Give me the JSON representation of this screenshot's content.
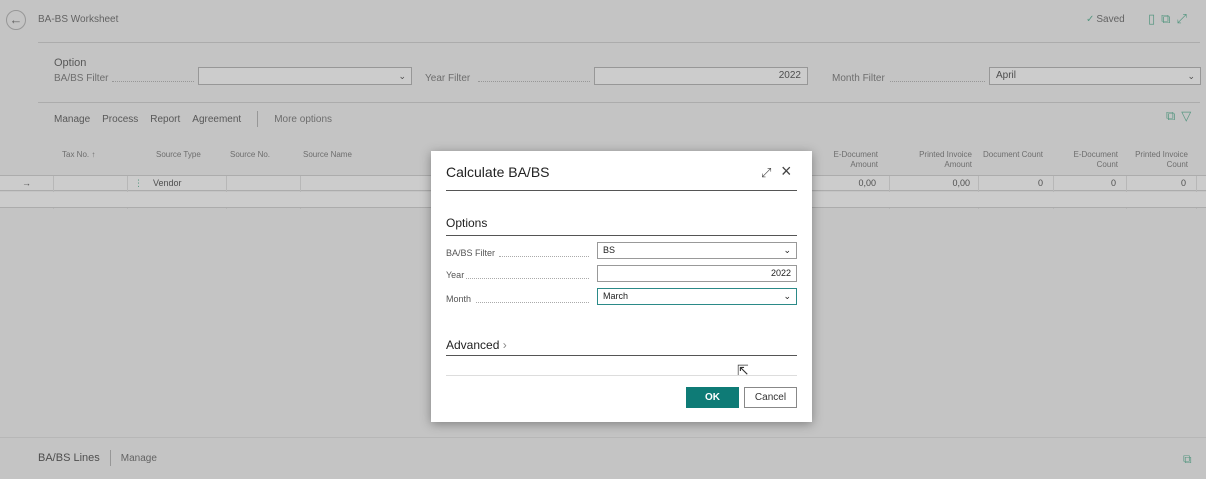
{
  "header": {
    "title": "BA-BS Worksheet",
    "saved_label": "Saved"
  },
  "options": {
    "title": "Option",
    "babs_filter_label": "BA/BS Filter",
    "babs_filter_value": "",
    "year_filter_label": "Year Filter",
    "year_filter_value": "2022",
    "month_filter_label": "Month Filter",
    "month_filter_value": "April"
  },
  "actions": [
    "Manage",
    "Process",
    "Report",
    "Agreement"
  ],
  "more_options": "More options",
  "grid": {
    "columns": [
      "Tax No. ↑",
      "Source Type",
      "Source No.",
      "Source Name",
      "E-Document Amount",
      "Printed Invoice Amount",
      "Document Count",
      "E-Document Count",
      "Printed Invoice Count"
    ],
    "row": {
      "source_type": "Vendor",
      "edoc_amount": "0,00",
      "printed_amount": "0,00",
      "doc_count": "0",
      "edoc_count": "0",
      "printed_count": "0"
    }
  },
  "lines": {
    "title": "BA/BS Lines",
    "manage": "Manage"
  },
  "dialog": {
    "title": "Calculate BA/BS",
    "section": "Options",
    "babs_filter_label": "BA/BS Filter",
    "babs_filter_value": "BS",
    "year_label": "Year",
    "year_value": "2022",
    "month_label": "Month",
    "month_value": "March",
    "advanced": "Advanced",
    "ok": "OK",
    "cancel": "Cancel"
  },
  "colors": {
    "accent": "#0e7b76",
    "icon_green": "#44aa88"
  }
}
